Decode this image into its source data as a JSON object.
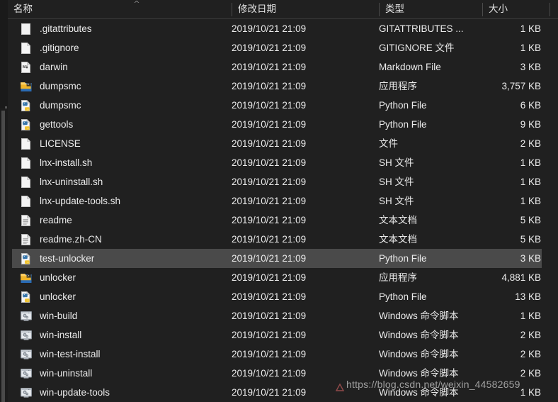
{
  "window": {
    "title": "File Explorer - Detail view",
    "theme": "dark",
    "bg_color": "#202020",
    "text_color": "#ebebeb",
    "selection_color": "#4a4a4a"
  },
  "header": {
    "columns": [
      {
        "label": "名称",
        "key": "name",
        "sorted": true,
        "sort_direction": "ascending"
      },
      {
        "label": "修改日期",
        "key": "date"
      },
      {
        "label": "类型",
        "key": "type"
      },
      {
        "label": "大小",
        "key": "size"
      }
    ],
    "sort_indicator_glyph": "^"
  },
  "scrollbar": {
    "orientation": "vertical",
    "position": "left",
    "thumb_top_pct": 27,
    "thumb_height_pct": 73
  },
  "files": [
    {
      "name": ".gitattributes",
      "date": "2019/10/21 21:09",
      "type": "GITATTRIBUTES ...",
      "size": "1 KB",
      "icon": "blank-file-icon",
      "selected": false
    },
    {
      "name": ".gitignore",
      "date": "2019/10/21 21:09",
      "type": "GITIGNORE 文件",
      "size": "1 KB",
      "icon": "page-file-icon",
      "selected": false
    },
    {
      "name": "darwin",
      "date": "2019/10/21 21:09",
      "type": "Markdown File",
      "size": "3 KB",
      "icon": "markdown-file-icon",
      "selected": false
    },
    {
      "name": "dumpsmc",
      "date": "2019/10/21 21:09",
      "type": "应用程序",
      "size": "3,757 KB",
      "icon": "application-exe-icon",
      "selected": false
    },
    {
      "name": "dumpsmc",
      "date": "2019/10/21 21:09",
      "type": "Python File",
      "size": "6 KB",
      "icon": "python-file-icon",
      "selected": false
    },
    {
      "name": "gettools",
      "date": "2019/10/21 21:09",
      "type": "Python File",
      "size": "9 KB",
      "icon": "python-file-icon",
      "selected": false
    },
    {
      "name": "LICENSE",
      "date": "2019/10/21 21:09",
      "type": "文件",
      "size": "2 KB",
      "icon": "page-file-icon",
      "selected": false
    },
    {
      "name": "lnx-install.sh",
      "date": "2019/10/21 21:09",
      "type": "SH 文件",
      "size": "1 KB",
      "icon": "page-file-icon",
      "selected": false
    },
    {
      "name": "lnx-uninstall.sh",
      "date": "2019/10/21 21:09",
      "type": "SH 文件",
      "size": "1 KB",
      "icon": "page-file-icon",
      "selected": false
    },
    {
      "name": "lnx-update-tools.sh",
      "date": "2019/10/21 21:09",
      "type": "SH 文件",
      "size": "1 KB",
      "icon": "page-file-icon",
      "selected": false
    },
    {
      "name": "readme",
      "date": "2019/10/21 21:09",
      "type": "文本文档",
      "size": "5 KB",
      "icon": "text-document-icon",
      "selected": false
    },
    {
      "name": "readme.zh-CN",
      "date": "2019/10/21 21:09",
      "type": "文本文档",
      "size": "5 KB",
      "icon": "text-document-icon",
      "selected": false
    },
    {
      "name": "test-unlocker",
      "date": "2019/10/21 21:09",
      "type": "Python File",
      "size": "3 KB",
      "icon": "python-file-icon",
      "selected": true
    },
    {
      "name": "unlocker",
      "date": "2019/10/21 21:09",
      "type": "应用程序",
      "size": "4,881 KB",
      "icon": "application-exe-icon",
      "selected": false
    },
    {
      "name": "unlocker",
      "date": "2019/10/21 21:09",
      "type": "Python File",
      "size": "13 KB",
      "icon": "python-file-icon",
      "selected": false
    },
    {
      "name": "win-build",
      "date": "2019/10/21 21:09",
      "type": "Windows 命令脚本",
      "size": "1 KB",
      "icon": "batch-script-icon",
      "selected": false
    },
    {
      "name": "win-install",
      "date": "2019/10/21 21:09",
      "type": "Windows 命令脚本",
      "size": "2 KB",
      "icon": "batch-script-icon",
      "selected": false
    },
    {
      "name": "win-test-install",
      "date": "2019/10/21 21:09",
      "type": "Windows 命令脚本",
      "size": "2 KB",
      "icon": "batch-script-icon",
      "selected": false
    },
    {
      "name": "win-uninstall",
      "date": "2019/10/21 21:09",
      "type": "Windows 命令脚本",
      "size": "2 KB",
      "icon": "batch-script-icon",
      "selected": false
    },
    {
      "name": "win-update-tools",
      "date": "2019/10/21 21:09",
      "type": "Windows 命令脚本",
      "size": "1 KB",
      "icon": "batch-script-icon",
      "selected": false
    }
  ],
  "watermark": {
    "text": "https://blog.csdn.net/weixin_44582659"
  }
}
